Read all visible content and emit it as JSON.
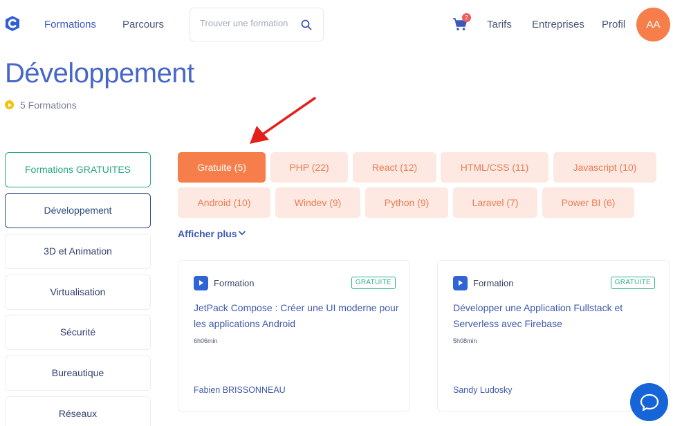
{
  "header": {
    "nav": [
      "Formations",
      "Parcours"
    ],
    "search_placeholder": "Trouver une formation",
    "cart_count": "2",
    "right_links": [
      "Tarifs",
      "Entreprises",
      "Profil"
    ],
    "avatar_initials": "AA"
  },
  "page": {
    "title": "Développement",
    "count_text": "5 Formations"
  },
  "sidebar": {
    "items": [
      "Formations GRATUITES",
      "Développement",
      "3D et Animation",
      "Virtualisation",
      "Sécurité",
      "Bureautique",
      "Réseaux"
    ]
  },
  "filters": {
    "pills": [
      "Gratuite (5)",
      "PHP (22)",
      "React (12)",
      "HTML/CSS (11)",
      "Javascript (10)",
      "Android (10)",
      "Windev (9)",
      "Python (9)",
      "Laravel (7)",
      "Power BI (6)"
    ],
    "more_label": "Afficher plus"
  },
  "cards": [
    {
      "type": "Formation",
      "badge": "GRATUITE",
      "title": "JetPack Compose : Créer une UI moderne pour les applications Android",
      "duration": "6h06min",
      "author": "Fabien BRISSONNEAU"
    },
    {
      "type": "Formation",
      "badge": "GRATUITE",
      "title": "Développer une Application Fullstack et Serverless avec Firebase",
      "duration": "5h08min",
      "author": "Sandy Ludosky"
    }
  ],
  "colors": {
    "accent": "#4767c8",
    "pill_active": "#f57e4a",
    "pill_bg": "#fde9e1",
    "free_green": "#27a881",
    "arrow_red": "#e3211c"
  }
}
